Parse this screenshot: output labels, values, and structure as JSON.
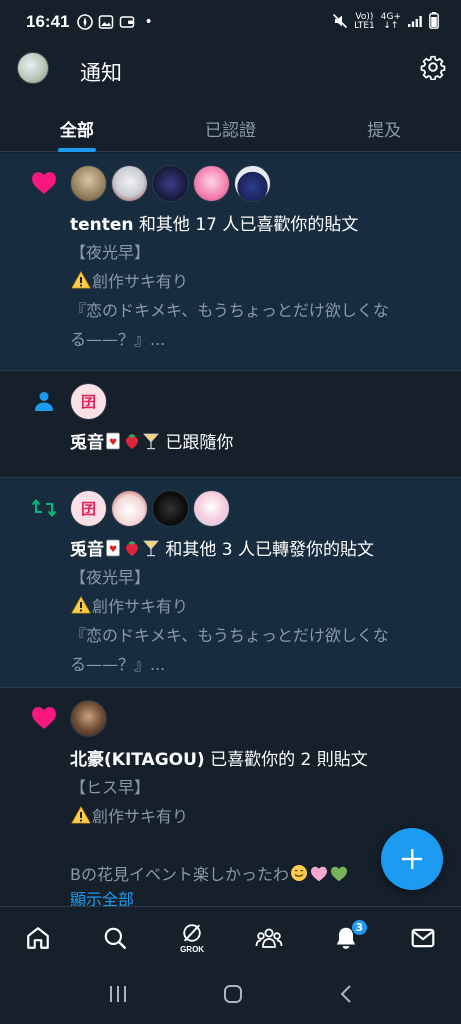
{
  "status": {
    "time": "16:41",
    "dot": "•",
    "volte": "Vo))",
    "lte": "LTE1",
    "net": "4G+",
    "arrows": "↓↑",
    "icons": [
      "compass-icon",
      "image-icon",
      "wallet-icon",
      "mute-icon",
      "signal-icon",
      "battery-icon"
    ]
  },
  "header": {
    "title": "通知"
  },
  "tabs": [
    {
      "label": "全部",
      "active": true
    },
    {
      "label": "已認證",
      "active": false
    },
    {
      "label": "提及",
      "active": false
    }
  ],
  "notifications": [
    {
      "type": "like",
      "name": "tenten",
      "action": " 和其他 17 人已喜歡你的貼文",
      "lines": [
        "【夜光早】",
        "創作サキ有り",
        "『恋のドキメキ、もうちょっとだけ欲しくな",
        "る——？』..."
      ]
    },
    {
      "type": "follow",
      "name": "兎音",
      "action": " 已跟隨你"
    },
    {
      "type": "repost",
      "name": "兎音",
      "action": " 和其他 3 人已轉發你的貼文",
      "lines": [
        "【夜光早】",
        "創作サキ有り",
        "『恋のドキメキ、もうちょっとだけ欲しくな",
        "る——？』..."
      ]
    },
    {
      "type": "like",
      "name": "北豪(KITAGOU)",
      "action": " 已喜歡你的 2 則貼文",
      "lines": [
        "【ヒス早】",
        "創作サキ有り",
        "",
        "Bの花見イベント楽しかったわ"
      ],
      "show_all": "顯示全部"
    }
  ],
  "avatar_badge_text": "囝",
  "bottom_nav": {
    "grok_label": "GROK",
    "notification_badge": "3"
  },
  "colors": {
    "accent": "#1d9bf0",
    "like": "#f91880",
    "repost": "#00ba7c",
    "background": "#15202b",
    "unread": "#172d3f"
  }
}
